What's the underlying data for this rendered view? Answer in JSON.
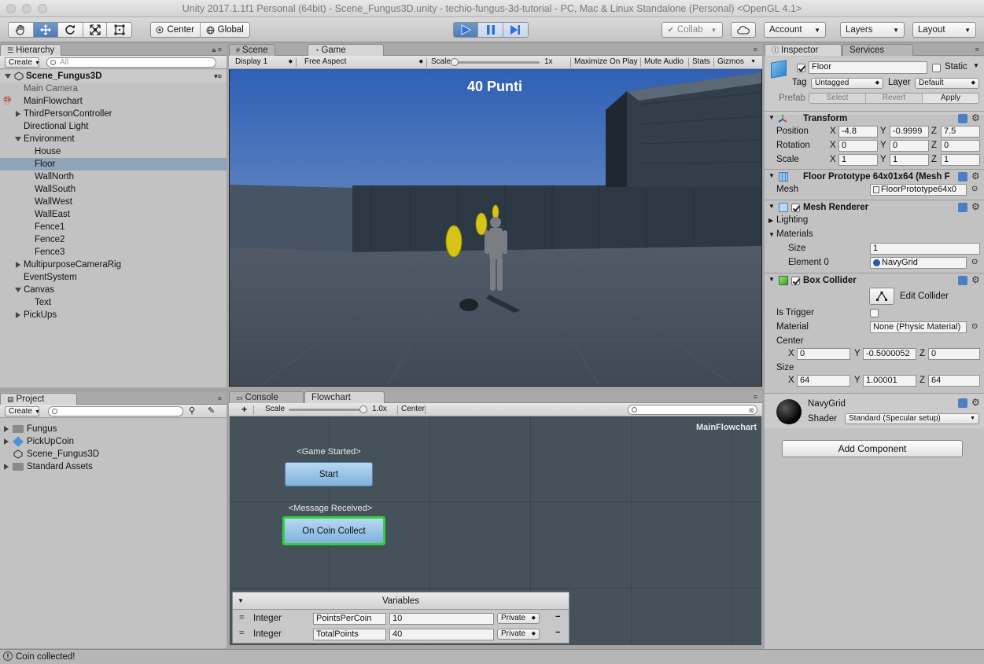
{
  "window": {
    "title": "Unity 2017.1.1f1 Personal (64bit) - Scene_Fungus3D.unity - techio-fungus-3d-tutorial - PC, Mac & Linux Standalone (Personal) <OpenGL 4.1>"
  },
  "toolbar": {
    "tools": [
      "hand-icon",
      "move-icon",
      "rotate-icon",
      "scale-icon",
      "rect-icon"
    ],
    "pivot_label": "Center",
    "space_label": "Global",
    "collab_label": "Collab",
    "account_label": "Account",
    "layers_label": "Layers",
    "layout_label": "Layout"
  },
  "hierarchy": {
    "tab": "Hierarchy",
    "create_label": "Create",
    "search_placeholder": "All",
    "scene_name": "Scene_Fungus3D",
    "items": [
      {
        "label": "Main Camera"
      },
      {
        "label": "MainFlowchart"
      },
      {
        "label": "ThirdPersonController"
      },
      {
        "label": "Directional Light"
      },
      {
        "label": "Environment"
      },
      {
        "label": "House"
      },
      {
        "label": "Floor"
      },
      {
        "label": "WallNorth"
      },
      {
        "label": "WallSouth"
      },
      {
        "label": "WallWest"
      },
      {
        "label": "WallEast"
      },
      {
        "label": "Fence1"
      },
      {
        "label": "Fence2"
      },
      {
        "label": "Fence3"
      },
      {
        "label": "MultipurposeCameraRig"
      },
      {
        "label": "EventSystem"
      },
      {
        "label": "Canvas"
      },
      {
        "label": "Text"
      },
      {
        "label": "PickUps"
      }
    ]
  },
  "scene_tabs": {
    "scene": "Scene",
    "game": "Game"
  },
  "game": {
    "display": "Display 1",
    "aspect": "Free Aspect",
    "scale_label": "Scale",
    "scale_value": "1x",
    "maximize": "Maximize On Play",
    "mute": "Mute Audio",
    "stats": "Stats",
    "gizmos": "Gizmos",
    "hud_text": "40 Punti"
  },
  "project": {
    "tab": "Project",
    "create_label": "Create",
    "items": [
      {
        "label": "Fungus"
      },
      {
        "label": "PickUpCoin"
      },
      {
        "label": "Scene_Fungus3D"
      },
      {
        "label": "Standard Assets"
      }
    ]
  },
  "flowchart": {
    "console_tab": "Console",
    "flowchart_tab": "Flowchart",
    "add_label": "+",
    "scale_label": "Scale",
    "scale_value": "1.0x",
    "center_label": "Center",
    "name": "MainFlowchart",
    "blocks": [
      {
        "event": "<Game Started>",
        "label": "Start"
      },
      {
        "event": "<Message Received>",
        "label": "On Coin Collect"
      }
    ],
    "variables": {
      "header": "Variables",
      "rows": [
        {
          "type": "Integer",
          "key": "PointsPerCoin",
          "value": "10",
          "scope": "Private"
        },
        {
          "type": "Integer",
          "key": "TotalPoints",
          "value": "40",
          "scope": "Private"
        }
      ]
    }
  },
  "inspector": {
    "tab": "Inspector",
    "services_tab": "Services",
    "object_name": "Floor",
    "static_label": "Static",
    "tag_label": "Tag",
    "tag_value": "Untagged",
    "layer_label": "Layer",
    "layer_value": "Default",
    "prefab_label": "Prefab",
    "prefab_select": "Select",
    "prefab_revert": "Revert",
    "prefab_apply": "Apply",
    "transform": {
      "title": "Transform",
      "rows": [
        {
          "label": "Position",
          "x": "-4.8",
          "y": "-0.9999",
          "z": "7.5"
        },
        {
          "label": "Rotation",
          "x": "0",
          "y": "0",
          "z": "0"
        },
        {
          "label": "Scale",
          "x": "1",
          "y": "1",
          "z": "1"
        }
      ]
    },
    "mesh_filter": {
      "title": "Floor Prototype 64x01x64 (Mesh F",
      "mesh_label": "Mesh",
      "mesh_value": "FloorPrototype64x0"
    },
    "mesh_renderer": {
      "title": "Mesh Renderer",
      "lighting": "Lighting",
      "materials": "Materials",
      "size_label": "Size",
      "size_value": "1",
      "element_label": "Element 0",
      "element_value": "NavyGrid"
    },
    "box_collider": {
      "title": "Box Collider",
      "edit_label": "Edit Collider",
      "trigger_label": "Is Trigger",
      "material_label": "Material",
      "material_value": "None (Physic Material)",
      "center_label": "Center",
      "center": {
        "x": "0",
        "y": "-0.5000052",
        "z": "0"
      },
      "size_label": "Size",
      "size": {
        "x": "64",
        "y": "1.00001",
        "z": "64"
      }
    },
    "material": {
      "name": "NavyGrid",
      "shader_label": "Shader",
      "shader_value": "Standard (Specular setup)"
    },
    "add_component": "Add Component"
  },
  "status": {
    "message": "Coin collected!"
  }
}
